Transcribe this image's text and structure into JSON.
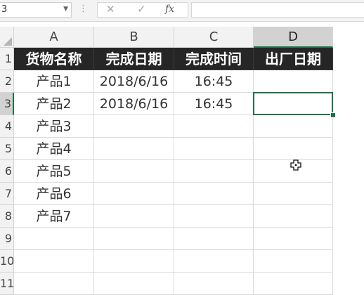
{
  "formula_bar": {
    "name_box": "3",
    "cancel_icon": "✕",
    "enter_icon": "✓",
    "function_label": "fx",
    "content": ""
  },
  "columns": [
    "A",
    "B",
    "C",
    "D"
  ],
  "rows": [
    "1",
    "2",
    "3",
    "4",
    "5",
    "6",
    "7",
    "8",
    "9",
    "10",
    "11"
  ],
  "header_row": [
    "货物名称",
    "完成日期",
    "完成时间",
    "出厂日期"
  ],
  "data_rows": [
    [
      "产品1",
      "2018/6/16",
      "16:45",
      ""
    ],
    [
      "产品2",
      "2018/6/16",
      "16:45",
      ""
    ],
    [
      "产品3",
      "",
      "",
      ""
    ],
    [
      "产品4",
      "",
      "",
      ""
    ],
    [
      "产品5",
      "",
      "",
      ""
    ],
    [
      "产品6",
      "",
      "",
      ""
    ],
    [
      "产品7",
      "",
      "",
      ""
    ],
    [
      "",
      "",
      "",
      ""
    ],
    [
      "",
      "",
      "",
      ""
    ],
    [
      "",
      "",
      "",
      ""
    ]
  ],
  "selected_cell": "D3",
  "colors": {
    "header_fill": "#262626",
    "header_text": "#ffffff",
    "selection_accent": "#217346"
  }
}
